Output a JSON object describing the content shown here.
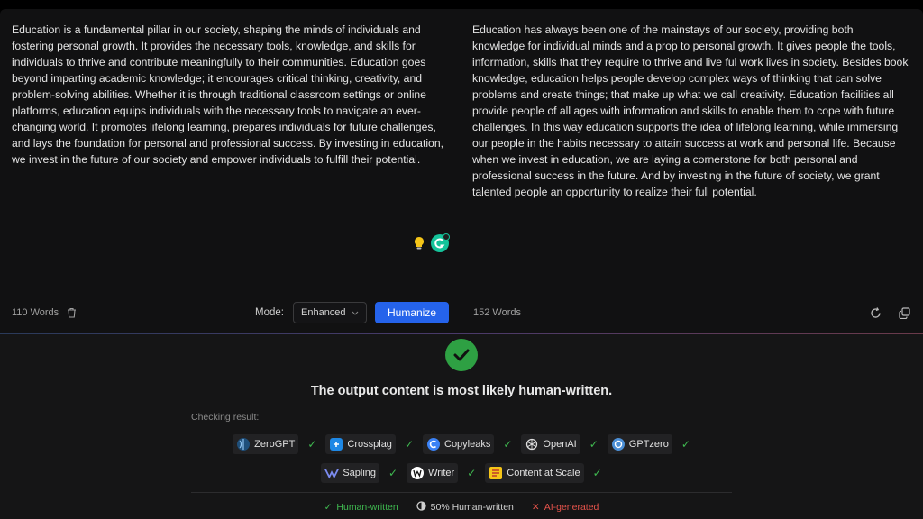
{
  "input_panel": {
    "text": "Education is a fundamental pillar in our society, shaping the minds of individuals and fostering personal growth. It provides the necessary tools, knowledge, and skills for individuals to thrive and contribute meaningfully to their communities. Education goes beyond imparting academic knowledge; it encourages critical thinking, creativity, and problem-solving abilities. Whether it is through traditional classroom settings or online platforms, education equips individuals with the necessary tools to navigate an ever-changing world. It promotes lifelong learning, prepares individuals for future challenges, and lays the foundation for personal and professional success. By investing in education, we invest in the future of our society and empower individuals to fulfill their potential.",
    "word_count": "110 Words",
    "mode_label": "Mode:",
    "mode_value": "Enhanced",
    "humanize_label": "Humanize"
  },
  "output_panel": {
    "text": "Education has always been one of the mainstays of our society, providing both knowledge for individual minds and a prop to personal growth. It gives people the tools, information, skills that they require to thrive and live ful work lives in society. Besides book knowledge, education helps people develop complex ways of thinking that can solve problems and create things; that make up what we call creativity. Education facilities all provide people of all ages with information and skills to enable them to cope with future challenges. In this way education supports the idea of lifelong learning, while immersing our people in the habits necessary to attain success at work and personal life. Because when we invest in education, we are laying a cornerstone for both personal and professional success in the future. And by investing in the future of society, we grant talented people an opportunity to realize their full potential.",
    "word_count": "152 Words"
  },
  "result": {
    "title": "The output content is most likely human-written.",
    "checking_label": "Checking result:",
    "detectors_row1": [
      {
        "name": "ZeroGPT",
        "icon": "zerogpt-icon"
      },
      {
        "name": "Crossplag",
        "icon": "crossplag-icon"
      },
      {
        "name": "Copyleaks",
        "icon": "copyleaks-icon"
      },
      {
        "name": "OpenAI",
        "icon": "openai-icon"
      },
      {
        "name": "GPTzero",
        "icon": "gptzero-icon"
      }
    ],
    "detectors_row2": [
      {
        "name": "Sapling",
        "icon": "sapling-icon"
      },
      {
        "name": "Writer",
        "icon": "writer-icon"
      },
      {
        "name": "Content at Scale",
        "icon": "content-at-scale-icon"
      }
    ],
    "legend": {
      "human": "Human-written",
      "half": "50% Human-written",
      "ai": "AI-generated"
    }
  },
  "colors": {
    "accent": "#2563eb",
    "success": "#2ea043",
    "danger": "#e5534b"
  }
}
